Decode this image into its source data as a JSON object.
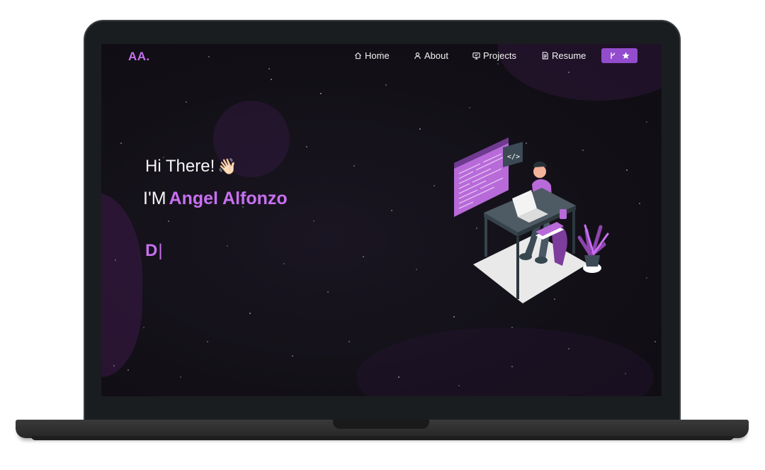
{
  "navbar": {
    "logo": "AA.",
    "items": [
      {
        "label": "Home",
        "icon": "home-icon"
      },
      {
        "label": "About",
        "icon": "user-icon"
      },
      {
        "label": "Projects",
        "icon": "projects-icon"
      },
      {
        "label": "Resume",
        "icon": "document-icon"
      }
    ],
    "star_button": {
      "icons": [
        "fork-icon",
        "star-icon"
      ]
    }
  },
  "hero": {
    "greeting": "Hi There!",
    "wave_emoji": "👋🏻",
    "intro_prefix": "I'M",
    "name": "Angel Alfonzo",
    "typed_text": "D",
    "cursor": "|"
  },
  "colors": {
    "accent": "#c770f0",
    "button": "#934cce",
    "background": "#121016",
    "bezel": "#1a1d20"
  }
}
